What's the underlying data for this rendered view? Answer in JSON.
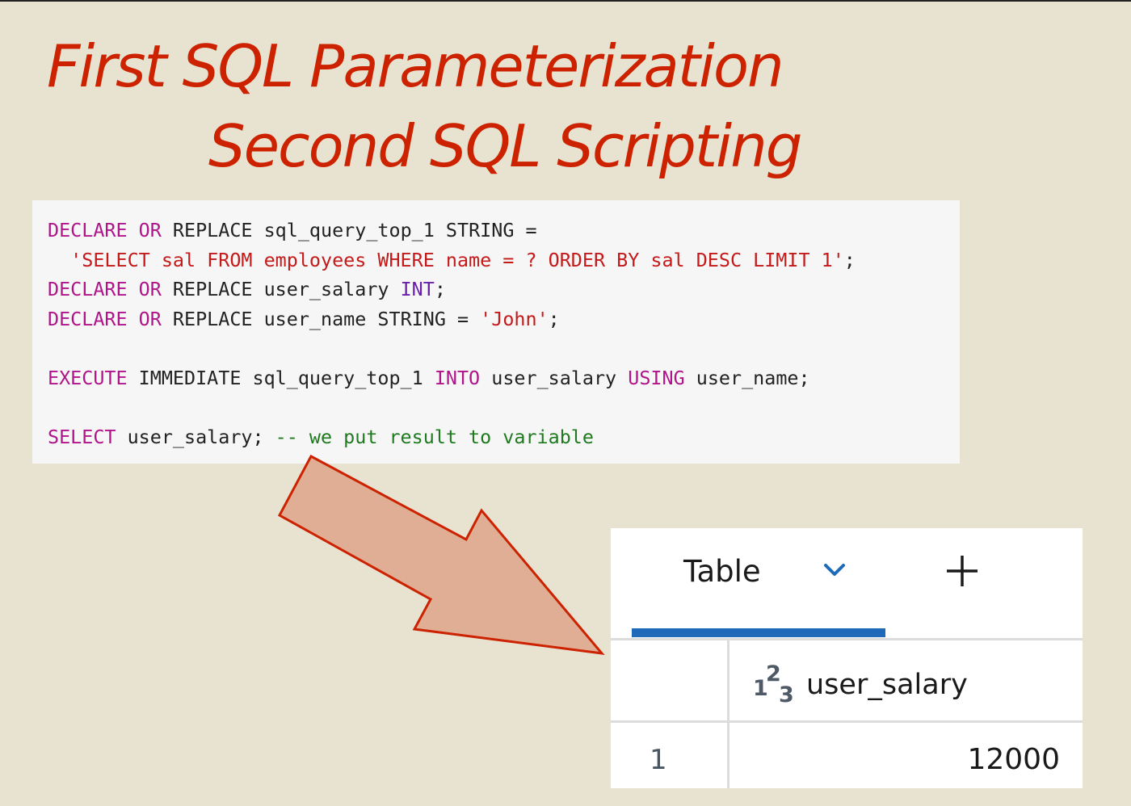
{
  "colors": {
    "background": "#e8e2d0",
    "title": "#cc2200",
    "keyword": "#b0148a",
    "type": "#6b1fa8",
    "string": "#c41a1a",
    "comment": "#1f7a1f",
    "plain": "#222222",
    "arrow_fill": "#e0ae94",
    "arrow_stroke": "#cc2200",
    "tab_underline": "#1e6ab8"
  },
  "title": {
    "line1": "First SQL Parameterization",
    "line2": "Second SQL Scripting"
  },
  "code": {
    "lines": [
      [
        {
          "text": "DECLARE",
          "kind": "keyword"
        },
        {
          "text": " ",
          "kind": "plain"
        },
        {
          "text": "OR",
          "kind": "keyword"
        },
        {
          "text": " REPLACE sql_query_top_1 STRING =",
          "kind": "plain"
        }
      ],
      [
        {
          "text": "  ",
          "kind": "plain"
        },
        {
          "text": "'SELECT sal FROM employees WHERE name = ? ORDER BY sal DESC LIMIT 1'",
          "kind": "string"
        },
        {
          "text": ";",
          "kind": "plain"
        }
      ],
      [
        {
          "text": "DECLARE",
          "kind": "keyword"
        },
        {
          "text": " ",
          "kind": "plain"
        },
        {
          "text": "OR",
          "kind": "keyword"
        },
        {
          "text": " REPLACE user_salary ",
          "kind": "plain"
        },
        {
          "text": "INT",
          "kind": "type"
        },
        {
          "text": ";",
          "kind": "plain"
        }
      ],
      [
        {
          "text": "DECLARE",
          "kind": "keyword"
        },
        {
          "text": " ",
          "kind": "plain"
        },
        {
          "text": "OR",
          "kind": "keyword"
        },
        {
          "text": " REPLACE user_name STRING = ",
          "kind": "plain"
        },
        {
          "text": "'John'",
          "kind": "string"
        },
        {
          "text": ";",
          "kind": "plain"
        }
      ],
      [],
      [
        {
          "text": "EXECUTE",
          "kind": "keyword"
        },
        {
          "text": " IMMEDIATE sql_query_top_1 ",
          "kind": "plain"
        },
        {
          "text": "INTO",
          "kind": "keyword"
        },
        {
          "text": " user_salary ",
          "kind": "plain"
        },
        {
          "text": "USING",
          "kind": "keyword"
        },
        {
          "text": " user_name;",
          "kind": "plain"
        }
      ],
      [],
      [
        {
          "text": "SELECT",
          "kind": "keyword"
        },
        {
          "text": " user_salary; ",
          "kind": "plain"
        },
        {
          "text": "-- we put result to variable",
          "kind": "comment"
        }
      ]
    ]
  },
  "result": {
    "tab_label": "Table",
    "tab_icon": "chevron-down-icon",
    "add_icon": "plus-icon",
    "column_type_icon": "integer-type-icon",
    "column_header": "user_salary",
    "rows": [
      {
        "index": "1",
        "value": "12000"
      }
    ]
  }
}
